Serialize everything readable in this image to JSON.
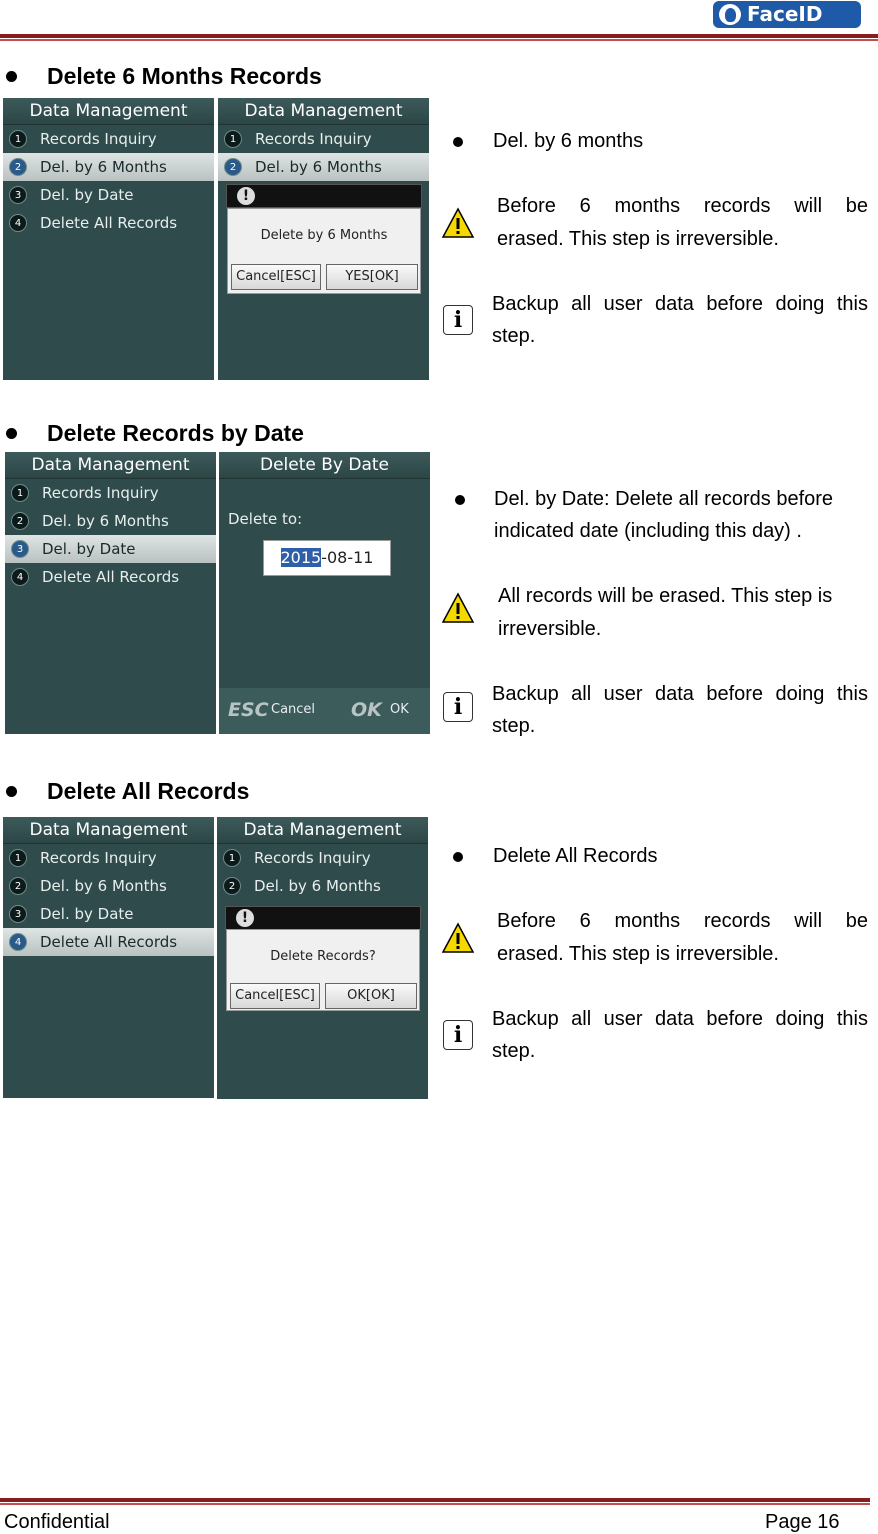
{
  "header": {
    "logo_text": "FaceID",
    "brand_color": "#1e5aa8",
    "rule_color": "#8b1c1c"
  },
  "sections": [
    {
      "title": "Delete 6 Months Records",
      "screen_left": {
        "title": "Data Management",
        "items": [
          "Records Inquiry",
          "Del. by 6 Months",
          "Del. by Date",
          "Delete All Records"
        ],
        "nums": [
          "1",
          "2",
          "3",
          "4"
        ]
      },
      "screen_right": {
        "title": "Data Management",
        "items": [
          "Records Inquiry",
          "Del. by 6 Months"
        ],
        "nums": [
          "1",
          "2"
        ],
        "dialog_msg": "Delete by 6 Months",
        "cancel": "Cancel[ESC]",
        "ok": "YES[OK]"
      },
      "bullet_text": "Del. by 6 months",
      "warning_text": "Before 6 months records will be erased. This step is irreversible.",
      "warning_line1": "Before 6 months records will be",
      "warning_line2": "erased. This step is irreversible.",
      "info_line1": "Backup all user data before doing this",
      "info_line2": "step."
    },
    {
      "title": "Delete Records by Date",
      "screen_left": {
        "title": "Data Management",
        "items": [
          "Records Inquiry",
          "Del. by 6 Months",
          "Del. by Date",
          "Delete All Records"
        ],
        "nums": [
          "1",
          "2",
          "3",
          "4"
        ]
      },
      "screen_right": {
        "title": "Delete By Date",
        "label": "Delete to:",
        "date_year": "2015",
        "date_rest": "-08-11",
        "esc_key": "ESC",
        "esc_label": "Cancel",
        "ok_key": "OK",
        "ok_label": "OK"
      },
      "bullet_line1": "Del. by Date: Delete all records before",
      "bullet_line2": "indicated date (including this day) .",
      "warning_line1": "All records will be erased. This step is",
      "warning_line2": "irreversible.",
      "info_line1": "Backup all user data before doing this",
      "info_line2": "step."
    },
    {
      "title": "Delete All Records",
      "screen_left": {
        "title": "Data Management",
        "items": [
          "Records Inquiry",
          "Del. by 6 Months",
          "Del. by Date",
          "Delete All Records"
        ],
        "nums": [
          "1",
          "2",
          "3",
          "4"
        ]
      },
      "screen_right": {
        "title": "Data Management",
        "items": [
          "Records Inquiry",
          "Del. by 6 Months"
        ],
        "nums": [
          "1",
          "2"
        ],
        "dialog_msg": "Delete Records?",
        "cancel": "Cancel[ESC]",
        "ok": "OK[OK]"
      },
      "bullet_text": "Delete All Records",
      "warning_line1": "Before 6 months records will be",
      "warning_line2": "erased. This step is irreversible.",
      "info_line1": "Backup all user data before doing this",
      "info_line2": "step."
    }
  ],
  "footer": {
    "left": "Confidential",
    "right": "Page 16"
  }
}
